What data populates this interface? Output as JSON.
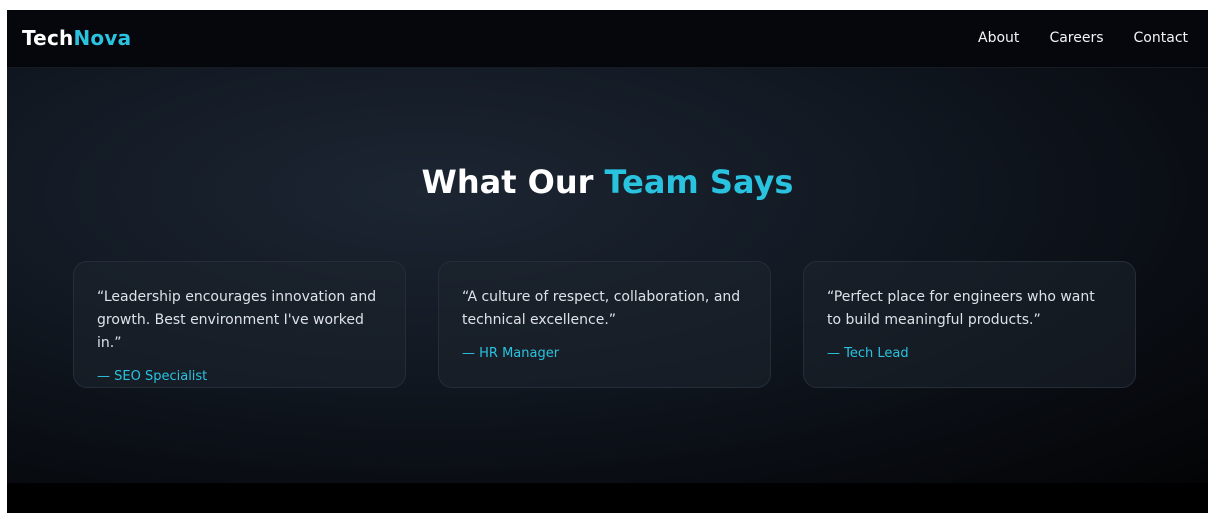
{
  "brand": {
    "part1": "Tech",
    "part2": "Nova"
  },
  "nav": {
    "links": [
      "About",
      "Careers",
      "Contact"
    ]
  },
  "section": {
    "title_part1": "What Our ",
    "title_part2": "Team Says"
  },
  "testimonials": [
    {
      "quote": "“Leadership encourages innovation and growth. Best environment I've worked in.”",
      "author": "— SEO Specialist"
    },
    {
      "quote": "“A culture of respect, collaboration, and technical excellence.”",
      "author": "— HR Manager"
    },
    {
      "quote": "“Perfect place for engineers who want to build meaningful products.”",
      "author": "— Tech Lead"
    }
  ],
  "colors": {
    "accent": "#29c3e0",
    "background": "#0b0f15",
    "text": "#ffffff"
  }
}
